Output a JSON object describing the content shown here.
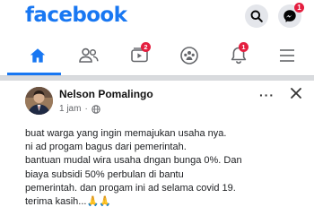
{
  "app": {
    "logo": "facebook"
  },
  "header": {
    "search_icon": "search-icon",
    "messenger_icon": "messenger-icon",
    "messenger_badge": "1"
  },
  "nav": {
    "items": [
      {
        "name": "home",
        "icon": "home-icon",
        "active": true
      },
      {
        "name": "friends",
        "icon": "friends-icon"
      },
      {
        "name": "watch",
        "icon": "video-icon",
        "badge": "2"
      },
      {
        "name": "groups",
        "icon": "groups-icon"
      },
      {
        "name": "notifications",
        "icon": "bell-icon",
        "badge": "1"
      },
      {
        "name": "menu",
        "icon": "menu-icon"
      }
    ]
  },
  "post": {
    "author": "Nelson Pomalingo",
    "time": "1 jam",
    "privacy_icon": "globe-icon",
    "more_label": "···",
    "lines": [
      "buat warga yang ingin memajukan usaha nya.",
      "ni ad progam bagus dari pemerintah.",
      "bantuan mudal wira usaha dngan bunga 0%. Dan",
      "biaya subsidi 50% perbulan di bantu",
      "pemerintah. dan progam ini ad selama covid 19.",
      "terima kasih..."
    ],
    "emoji": "🙏🙏"
  },
  "colors": {
    "brand": "#1877f2",
    "badge": "#e41e3f"
  }
}
